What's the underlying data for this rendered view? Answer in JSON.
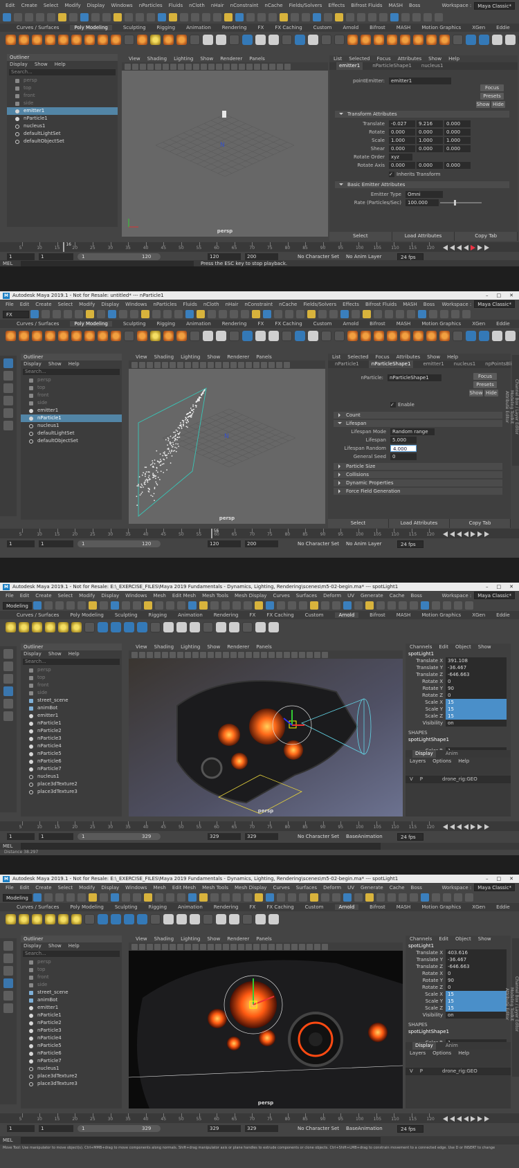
{
  "s1": {
    "menu": [
      "Edit",
      "Create",
      "Select",
      "Modify",
      "Display",
      "Windows",
      "nParticles",
      "Fluids",
      "nCloth",
      "nHair",
      "nConstraint",
      "nCache",
      "Fields/Solvers",
      "Effects",
      "Bifrost Fluids",
      "MASH",
      "Boss"
    ],
    "workspace_label": "Workspace :",
    "workspace": "Maya Classic*",
    "shelf_tabs": [
      "Curves / Surfaces",
      "Poly Modeling",
      "Sculpting",
      "Rigging",
      "Animation",
      "Rendering",
      "FX",
      "FX Caching",
      "Custom",
      "Arnold",
      "Bifrost",
      "MASH",
      "Motion Graphics",
      "XGen",
      "Eddie"
    ],
    "active_tab": "Poly Modeling",
    "outliner": {
      "title": "Outliner",
      "menu": [
        "Display",
        "Show",
        "Help"
      ],
      "search": "Search...",
      "items": [
        {
          "t": "persp",
          "d": 1,
          "i": "cam"
        },
        {
          "t": "top",
          "d": 1,
          "i": "cam"
        },
        {
          "t": "front",
          "d": 1,
          "i": "cam"
        },
        {
          "t": "side",
          "d": 1,
          "i": "cam"
        },
        {
          "t": "emitter1",
          "s": 1,
          "i": "pt"
        },
        {
          "t": "nParticle1",
          "i": "pt"
        },
        {
          "t": "nucleus1",
          "i": "ring"
        },
        {
          "t": "defaultLightSet",
          "i": "ring"
        },
        {
          "t": "defaultObjectSet",
          "i": "ring"
        }
      ]
    },
    "vp_menu": [
      "View",
      "Shading",
      "Lighting",
      "Show",
      "Renderer",
      "Panels"
    ],
    "camera": "persp",
    "ae": {
      "menu": [
        "List",
        "Selected",
        "Focus",
        "Attributes",
        "Show",
        "Help"
      ],
      "tabs": [
        "emitter1",
        "nParticleShape1",
        "nucleus1"
      ],
      "node_label": "pointEmitter:",
      "node": "emitter1",
      "focus": "Focus",
      "presets": "Presets",
      "show": "Show",
      "hide": "Hide",
      "sect1": "Transform Attributes",
      "rows": [
        {
          "l": "Translate",
          "v": [
            "-0.027",
            "9.216",
            "0.000"
          ]
        },
        {
          "l": "Rotate",
          "v": [
            "0.000",
            "0.000",
            "0.000"
          ]
        },
        {
          "l": "Scale",
          "v": [
            "1.000",
            "1.000",
            "1.000"
          ]
        },
        {
          "l": "Shear",
          "v": [
            "0.000",
            "0.000",
            "0.000"
          ]
        },
        {
          "l": "Rotate Order",
          "v": [
            "xyz"
          ]
        },
        {
          "l": "Rotate Axis",
          "v": [
            "0.000",
            "0.000",
            "0.000"
          ]
        }
      ],
      "inherits": "Inherits Transform",
      "sect2": "Basic Emitter Attributes",
      "emitter_type_label": "Emitter Type",
      "emitter_type": "Omni",
      "rate_label": "Rate (Particles/Sec)",
      "rate": "100.000",
      "buttons": [
        "Select",
        "Load Attributes",
        "Copy Tab"
      ]
    },
    "ticks": [
      "5",
      "10",
      "15",
      "20",
      "25",
      "30",
      "35",
      "40",
      "45",
      "50",
      "55",
      "60",
      "65",
      "70",
      "75",
      "80",
      "85",
      "90",
      "95",
      "100",
      "105",
      "110",
      "115",
      "120"
    ],
    "current_frame": "16",
    "range": {
      "a": "1",
      "b": "1",
      "c": "120",
      "d": "120",
      "e": "200",
      "charset": "No Character Set",
      "animlayer": "No Anim Layer",
      "fps": "24 fps"
    },
    "mel": "MEL",
    "help": "Press the ESC key to stop playback."
  },
  "s2": {
    "title": "Autodesk Maya 2019.1 - Not for Resale: untitled*   ---   nParticle1",
    "menu": [
      "File",
      "Edit",
      "Create",
      "Select",
      "Modify",
      "Display",
      "Windows",
      "nParticles",
      "Fluids",
      "nCloth",
      "nHair",
      "nConstraint",
      "nCache",
      "Fields/Solvers",
      "Effects",
      "Bifrost Fluids",
      "MASH",
      "Boss"
    ],
    "mode": "FX",
    "outliner_items": [
      {
        "t": "persp",
        "d": 1,
        "i": "cam"
      },
      {
        "t": "top",
        "d": 1,
        "i": "cam"
      },
      {
        "t": "front",
        "d": 1,
        "i": "cam"
      },
      {
        "t": "side",
        "d": 1,
        "i": "cam"
      },
      {
        "t": "emitter1",
        "i": "pt"
      },
      {
        "t": "nParticle1",
        "s": 1,
        "i": "pt"
      },
      {
        "t": "nucleus1",
        "i": "ring"
      },
      {
        "t": "defaultLightSet",
        "i": "ring"
      },
      {
        "t": "defaultObjectSet",
        "i": "ring"
      }
    ],
    "ae": {
      "tabs": [
        "nParticle1",
        "nParticleShape1",
        "emitter1",
        "nucleus1",
        "npPointsBlinn"
      ],
      "node_label": "nParticle:",
      "node": "nParticleShape1",
      "enable": "Enable",
      "sects": [
        "Count",
        "Lifespan"
      ],
      "lifespan_mode_label": "Lifespan Mode",
      "lifespan_mode": "Random range",
      "lifespan_label": "Lifespan",
      "lifespan": "5.000",
      "lifespan_random_label": "Lifespan Random",
      "lifespan_random": "4.000",
      "seed_label": "General Seed",
      "seed": "0",
      "more": [
        "Particle Size",
        "Collisions",
        "Dynamic Properties",
        "Force Field Generation"
      ]
    },
    "side_tabs": [
      "Channel Box / Layer Editor",
      "Modeling Toolkit",
      "Attribute Editor"
    ],
    "current_frame": "56",
    "range": {
      "a": "1",
      "b": "1",
      "c": "120",
      "d": "120",
      "e": "200",
      "charset": "No Character Set",
      "animlayer": "No Anim Layer",
      "fps": "24 fps"
    }
  },
  "s3": {
    "title": "Autodesk Maya 2019.1 - Not for Resale: E:\\_EXERCISE_FILES\\Maya 2019 Fundamentals - Dynamics, Lighting, Rendering\\scenes\\m5-02-begin.ma*   ---   spotLight1",
    "menu": [
      "File",
      "Edit",
      "Create",
      "Select",
      "Modify",
      "Display",
      "Windows",
      "Mesh",
      "Edit Mesh",
      "Mesh Tools",
      "Mesh Display",
      "Curves",
      "Surfaces",
      "Deform",
      "UV",
      "Generate",
      "Cache",
      "Boss"
    ],
    "mode": "Modeling",
    "active_tab": "Arnold",
    "outliner_items": [
      {
        "t": "persp",
        "d": 1,
        "i": "cam"
      },
      {
        "t": "top",
        "d": 1,
        "i": "cam"
      },
      {
        "t": "front",
        "d": 1,
        "i": "cam"
      },
      {
        "t": "side",
        "d": 1,
        "i": "cam"
      },
      {
        "t": "street_scene",
        "i": "grp"
      },
      {
        "t": "animBot",
        "i": "grp"
      },
      {
        "t": "emitter1",
        "i": "pt"
      },
      {
        "t": "nParticle1",
        "i": "pt"
      },
      {
        "t": "nParticle2",
        "i": "pt"
      },
      {
        "t": "nParticle3",
        "i": "pt"
      },
      {
        "t": "nParticle4",
        "i": "pt"
      },
      {
        "t": "nParticle5",
        "i": "pt"
      },
      {
        "t": "nParticle6",
        "i": "pt"
      },
      {
        "t": "nParticle7",
        "i": "pt"
      },
      {
        "t": "nucleus1",
        "i": "ring"
      },
      {
        "t": "place3dTexture2",
        "i": "ring"
      },
      {
        "t": "place3dTexture3",
        "i": "ring"
      }
    ],
    "cb": {
      "menu": [
        "Channels",
        "Edit",
        "Object",
        "Show"
      ],
      "node": "spotLight1",
      "attrs": [
        {
          "k": "Translate X",
          "v": "391.108"
        },
        {
          "k": "Translate Y",
          "v": "-36.467"
        },
        {
          "k": "Translate Z",
          "v": "-646.663"
        },
        {
          "k": "Rotate X",
          "v": "0"
        },
        {
          "k": "Rotate Y",
          "v": "90"
        },
        {
          "k": "Rotate Z",
          "v": "0"
        },
        {
          "k": "Scale X",
          "v": "15",
          "h": 1
        },
        {
          "k": "Scale Y",
          "v": "15",
          "h": 1
        },
        {
          "k": "Scale Z",
          "v": "15",
          "h": 1
        },
        {
          "k": "Visibility",
          "v": "on"
        }
      ],
      "shapes": "SHAPES",
      "shape": "spotLightShape1",
      "color_label": "Color R",
      "color": "1",
      "layer_tabs": [
        "Display",
        "Anim"
      ],
      "layer_menu": [
        "Layers",
        "Options",
        "Help"
      ],
      "layer_v": "V",
      "layer_p": "P",
      "layer": "drone_rig:GEO"
    },
    "range": {
      "a": "1",
      "b": "1",
      "c": "329",
      "d": "329",
      "e": "329",
      "charset": "No Character Set",
      "animlayer": "BaseAnimation",
      "fps": "24 fps"
    },
    "distance_label": "Distance",
    "distance": "38.297"
  },
  "s4": {
    "cb_tx": "403.616",
    "help": "Move Tool: Use manipulator to move object(s). Ctrl+MMB+drag to move components along normals. Shift+drag manipulator axis or plane handles to extrude components or clone objects. Ctrl+Shift+LMB+drag to constrain movement to a connected edge. Use D or INSERT to change"
  }
}
